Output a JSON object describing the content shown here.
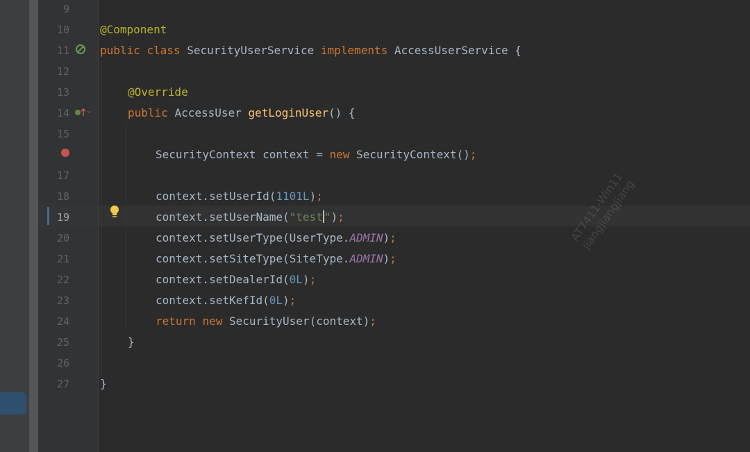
{
  "editor": {
    "lines": [
      {
        "num": "9"
      },
      {
        "num": "10",
        "tokens": [
          {
            "t": "@Component",
            "c": "ann"
          }
        ]
      },
      {
        "num": "11",
        "tokens": [
          {
            "t": "public ",
            "c": "kw"
          },
          {
            "t": "class ",
            "c": "kw"
          },
          {
            "t": "SecurityUserService ",
            "c": ""
          },
          {
            "t": "implements ",
            "c": "kw"
          },
          {
            "t": "AccessUserService {",
            "c": ""
          }
        ]
      },
      {
        "num": "12"
      },
      {
        "num": "13",
        "tokens": [
          {
            "t": "@Override",
            "c": "ann"
          }
        ]
      },
      {
        "num": "14",
        "tokens": [
          {
            "t": "public ",
            "c": "kw"
          },
          {
            "t": "AccessUser ",
            "c": ""
          },
          {
            "t": "getLoginUser",
            "c": "fn"
          },
          {
            "t": "() {",
            "c": ""
          }
        ]
      },
      {
        "num": "15"
      },
      {
        "num": "",
        "tokens": [
          {
            "t": "SecurityContext context = ",
            "c": ""
          },
          {
            "t": "new ",
            "c": "kw"
          },
          {
            "t": "SecurityContext()",
            "c": ""
          },
          {
            "t": ";",
            "c": "sep"
          }
        ]
      },
      {
        "num": "17"
      },
      {
        "num": "18",
        "tokens": [
          {
            "t": "context.setUserId(",
            "c": ""
          },
          {
            "t": "1101L",
            "c": "num"
          },
          {
            "t": ")",
            "c": ""
          },
          {
            "t": ";",
            "c": "sep"
          }
        ]
      },
      {
        "num": "19",
        "tokens": [
          {
            "t": "context.setUserName(",
            "c": ""
          },
          {
            "t": "\"test",
            "c": "str"
          },
          {
            "t": "|caret|",
            "c": "caret"
          },
          {
            "t": "\"",
            "c": "str"
          },
          {
            "t": ")",
            "c": ""
          },
          {
            "t": ";",
            "c": "sep"
          }
        ]
      },
      {
        "num": "20",
        "tokens": [
          {
            "t": "context.setUserType(UserType.",
            "c": ""
          },
          {
            "t": "ADMIN",
            "c": "const"
          },
          {
            "t": ")",
            "c": ""
          },
          {
            "t": ";",
            "c": "sep"
          }
        ]
      },
      {
        "num": "21",
        "tokens": [
          {
            "t": "context.setSiteType(SiteType.",
            "c": ""
          },
          {
            "t": "ADMIN",
            "c": "const"
          },
          {
            "t": ")",
            "c": ""
          },
          {
            "t": ";",
            "c": "sep"
          }
        ]
      },
      {
        "num": "22",
        "tokens": [
          {
            "t": "context.setDealerId(",
            "c": ""
          },
          {
            "t": "0L",
            "c": "num"
          },
          {
            "t": ")",
            "c": ""
          },
          {
            "t": ";",
            "c": "sep"
          }
        ]
      },
      {
        "num": "23",
        "tokens": [
          {
            "t": "context.setKefId(",
            "c": ""
          },
          {
            "t": "0L",
            "c": "num"
          },
          {
            "t": ")",
            "c": ""
          },
          {
            "t": ";",
            "c": "sep"
          }
        ]
      },
      {
        "num": "24",
        "tokens": [
          {
            "t": "return ",
            "c": "kw"
          },
          {
            "t": "new ",
            "c": "kw"
          },
          {
            "t": "SecurityUser(context)",
            "c": ""
          },
          {
            "t": ";",
            "c": "sep"
          }
        ]
      },
      {
        "num": "25",
        "tokens": [
          {
            "t": "}",
            "c": ""
          }
        ]
      },
      {
        "num": "26"
      },
      {
        "num": "27",
        "tokens": [
          {
            "t": "}",
            "c": ""
          }
        ]
      }
    ],
    "current_line": "19",
    "colors": {
      "background": "#2b2b2b",
      "keyword": "#cc7832",
      "annotation": "#bbb529",
      "method": "#ffc66d",
      "number": "#6897bb",
      "string": "#6a8759",
      "constant": "#9876aa",
      "breakpoint": "#c75450"
    },
    "gutter_icons": {
      "line_11": "spring-bean-icon",
      "line_14": "override-method-icon",
      "line_16": "breakpoint-icon",
      "line_19": "intention-bulb-icon"
    }
  },
  "watermark": {
    "line1": "AT7411-Win11",
    "line2": "jiangjiangjiang"
  }
}
